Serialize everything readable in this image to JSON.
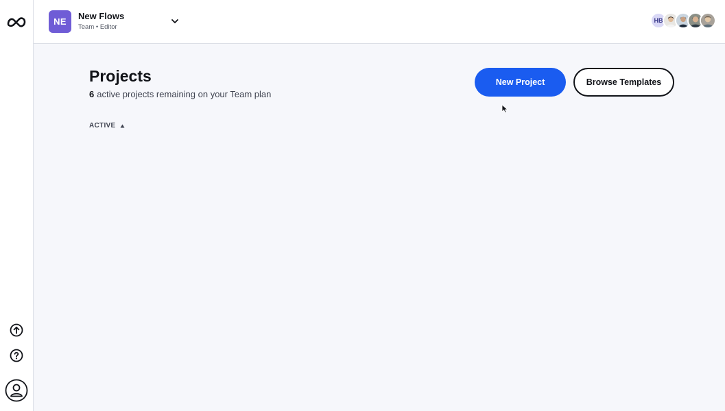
{
  "workspace": {
    "initials": "NE",
    "name": "New Flows",
    "role": "Team • Editor",
    "avatar_color": "#6f5cd6"
  },
  "members": [
    {
      "type": "initials",
      "text": "HB"
    },
    {
      "type": "photo",
      "name": "member-photo-1"
    },
    {
      "type": "photo",
      "name": "member-photo-2"
    },
    {
      "type": "photo",
      "name": "member-photo-3"
    },
    {
      "type": "photo",
      "name": "member-photo-4"
    }
  ],
  "sidebar": {
    "logo_icon": "infinity-logo-icon",
    "upload_icon": "upload-circle-icon",
    "help_icon": "help-circle-icon",
    "account_icon": "user-circle-icon"
  },
  "main": {
    "title": "Projects",
    "remaining_count": "6",
    "remaining_text": "active projects remaining on your Team plan",
    "new_project_label": "New Project",
    "browse_templates_label": "Browse Templates",
    "filter_label": "ACTIVE"
  },
  "colors": {
    "primary": "#1a5cf0",
    "background": "#f6f7fb",
    "text": "#111318"
  }
}
